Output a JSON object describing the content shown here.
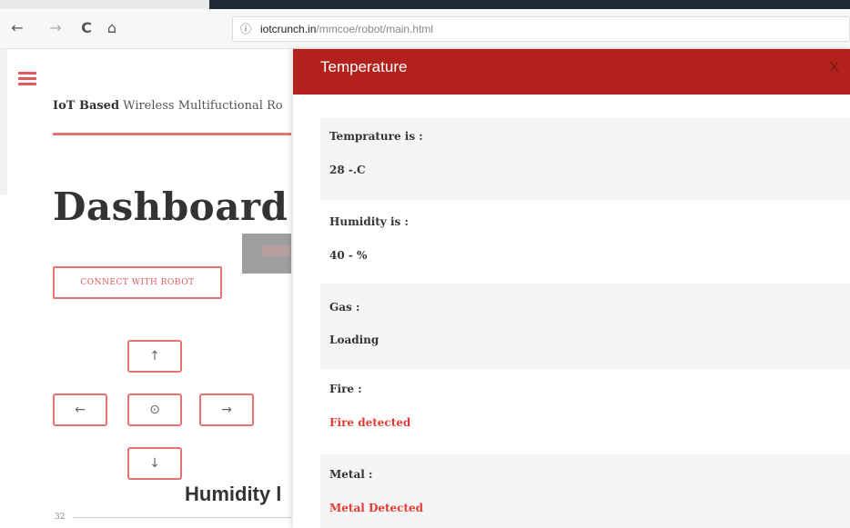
{
  "browser": {
    "back_icon": "←",
    "forward_icon": "→",
    "reload_icon": "C",
    "home_icon": "⌂",
    "info_icon": "ⓘ",
    "url_domain": "iotcrunch.in",
    "url_path": "/mmcoe/robot/main.html"
  },
  "page": {
    "title_bold": "IoT Based",
    "title_rest": " Wireless Multifuctional Ro",
    "heading": "Dashboard",
    "connect_label": "CONNECT WITH ROBOT",
    "controls": {
      "up": "↑",
      "left": "←",
      "stop": "⊙",
      "right": "→",
      "down": "↓"
    },
    "humidity_heading": "Humidity l",
    "small_number": "32"
  },
  "modal": {
    "title": "Temperature",
    "close_label": "X",
    "rows": [
      {
        "label": "Temprature is :",
        "value": "28 -.C"
      },
      {
        "label": "Humidity is :",
        "value": "40 - %"
      },
      {
        "label": "Gas :",
        "value": "Loading"
      },
      {
        "label": "Fire :",
        "value": "Fire detected"
      },
      {
        "label": "Metal :",
        "value": "Metal Detected"
      }
    ]
  },
  "colors": {
    "accent": "#e57373",
    "modal_header": "#b3211c",
    "alert_text": "#e53935"
  }
}
